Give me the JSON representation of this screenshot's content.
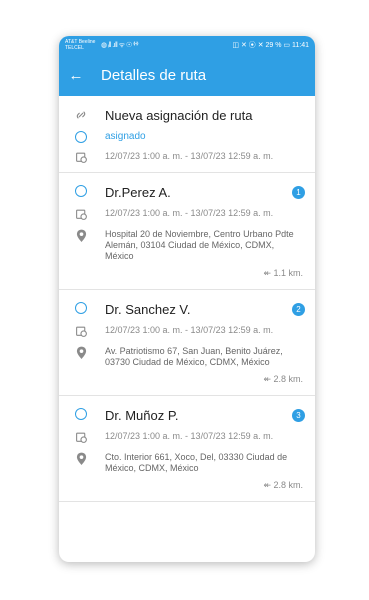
{
  "status_bar": {
    "carrier": "AT&T Beeline",
    "carrier2": "TELCEL",
    "signals": "◍ ᵢll .ıll ᯤ ☉ ⁽ᴴ⁾",
    "right": "◫ ✕ ⦿ ✕ 29 % ▭ 11:41"
  },
  "app_bar": {
    "title": "Detalles de ruta"
  },
  "header": {
    "title": "Nueva asignación de ruta",
    "status": "asignado",
    "date": "12/07/23 1:00 a. m. - 13/07/23 12:59 a. m."
  },
  "stops": [
    {
      "name": "Dr.Perez A.",
      "badge": "1",
      "date": "12/07/23 1:00 a. m. - 13/07/23 12:59 a. m.",
      "address": "Hospital 20 de Noviembre, Centro Urbano Pdte Alemán, 03104 Ciudad de México, CDMX, México",
      "distance": "1.1 km."
    },
    {
      "name": "Dr. Sanchez V.",
      "badge": "2",
      "date": "12/07/23 1:00 a. m. - 13/07/23 12:59 a. m.",
      "address": "Av. Patriotismo 67, San Juan, Benito Juárez, 03730 Ciudad de México, CDMX, México",
      "distance": "2.8 km."
    },
    {
      "name": "Dr. Muñoz P.",
      "badge": "3",
      "date": "12/07/23 1:00 a. m. - 13/07/23 12:59 a. m.",
      "address": "Cto. Interior 661, Xoco, Del, 03330 Ciudad de México, CDMX, México",
      "distance": "2.8 km."
    }
  ]
}
